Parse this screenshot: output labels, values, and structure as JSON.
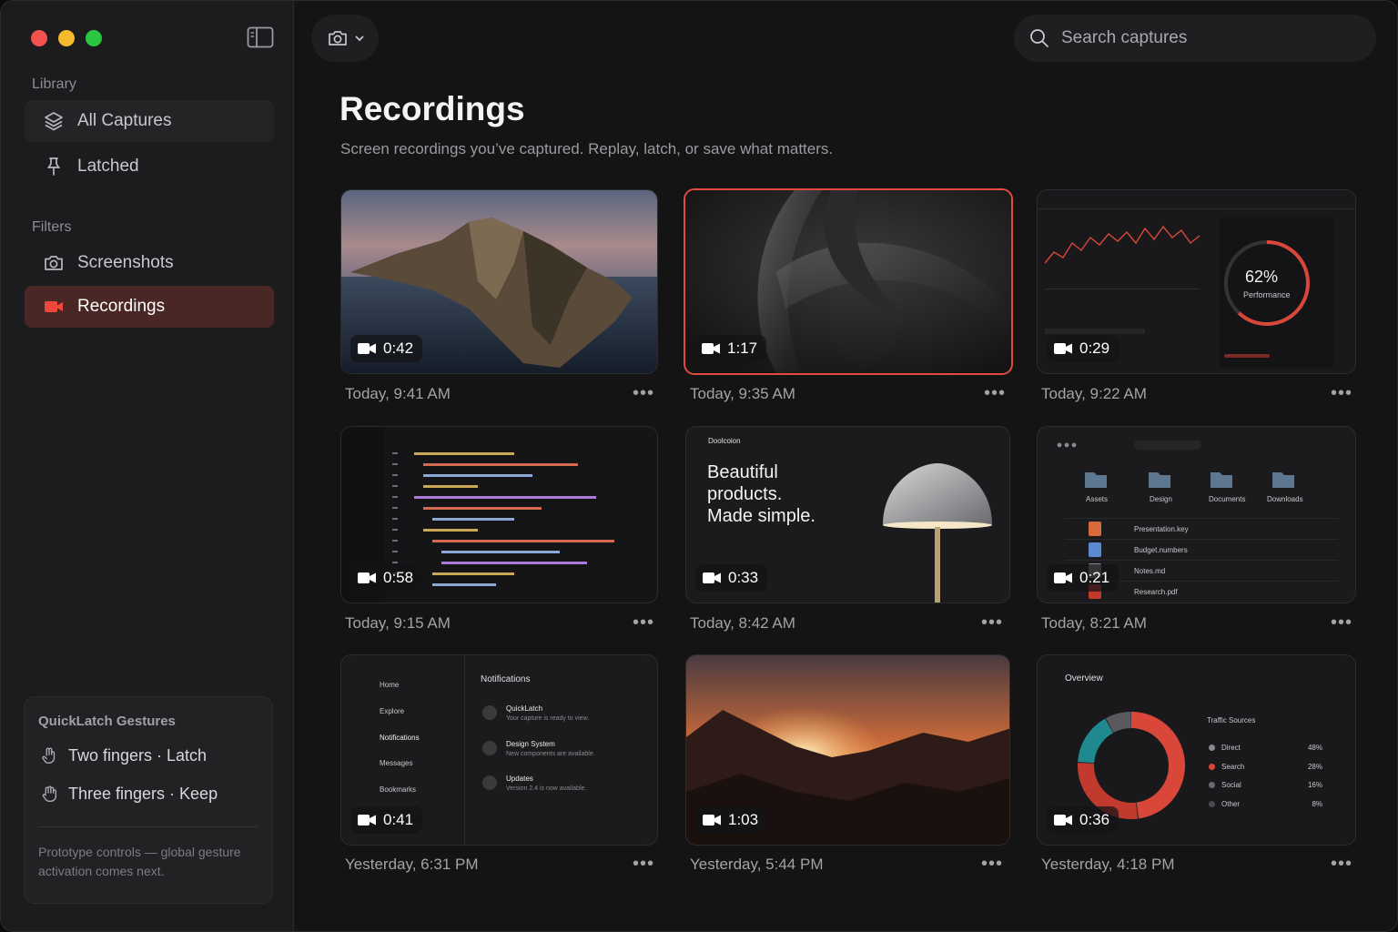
{
  "sidebar": {
    "library_label": "Library",
    "filters_label": "Filters",
    "items": [
      {
        "label": "All Captures"
      },
      {
        "label": "Latched"
      },
      {
        "label": "Screenshots"
      },
      {
        "label": "Recordings"
      }
    ],
    "gestures": {
      "title": "QuickLatch Gestures",
      "two": "Two fingers · Latch",
      "three": "Three fingers · Keep",
      "note": "Prototype controls — global gesture activation comes next."
    }
  },
  "search": {
    "placeholder": "Search captures"
  },
  "main": {
    "title": "Recordings",
    "subtitle": "Screen recordings you’ve captured. Replay, latch, or save what matters."
  },
  "cards": [
    {
      "duration": "0:42",
      "time": "Today, 9:41 AM"
    },
    {
      "duration": "1:17",
      "time": "Today, 9:35 AM"
    },
    {
      "duration": "0:29",
      "time": "Today, 9:22 AM"
    },
    {
      "duration": "0:58",
      "time": "Today, 9:15 AM"
    },
    {
      "duration": "0:33",
      "time": "Today, 8:42 AM"
    },
    {
      "duration": "0:21",
      "time": "Today, 8:21 AM"
    },
    {
      "duration": "0:41",
      "time": "Yesterday, 6:31 PM"
    },
    {
      "duration": "1:03",
      "time": "Yesterday, 5:44 PM"
    },
    {
      "duration": "0:36",
      "time": "Yesterday, 4:18 PM"
    }
  ],
  "more_label": "•••",
  "thumb_text": {
    "perf_value": "62%",
    "perf_label": "Performance",
    "promo_brand": "Doolcoion",
    "promo_line1": "Beautiful",
    "promo_line2": "products.",
    "promo_line3": "Made simple.",
    "folders": [
      "Assets",
      "Design",
      "Documents",
      "Downloads"
    ],
    "files": [
      "Presentation.key",
      "Budget.numbers",
      "Notes.md",
      "Research.pdf"
    ],
    "nav": [
      "Home",
      "Explore",
      "Notifications",
      "Messages",
      "Bookmarks"
    ],
    "notif_title": "Notifications",
    "notifs": [
      {
        "title": "QuickLatch",
        "body": "Your capture is ready to view."
      },
      {
        "title": "Design System",
        "body": "New components are available."
      },
      {
        "title": "Updates",
        "body": "Version 2.4 is now available."
      }
    ],
    "overview": "Overview",
    "traffic_title": "Traffic Sources",
    "traffic": [
      {
        "name": "Direct",
        "pct": "48%",
        "color": "#d8473a"
      },
      {
        "name": "Search",
        "pct": "28%",
        "color": "#c23a2e"
      },
      {
        "name": "Social",
        "pct": "16%",
        "color": "#1e8a8f"
      },
      {
        "name": "Other",
        "pct": "8%",
        "color": "#5a5a5e"
      }
    ]
  },
  "colors": {
    "accent": "#e5483f",
    "active_bg": "#4a2724"
  }
}
